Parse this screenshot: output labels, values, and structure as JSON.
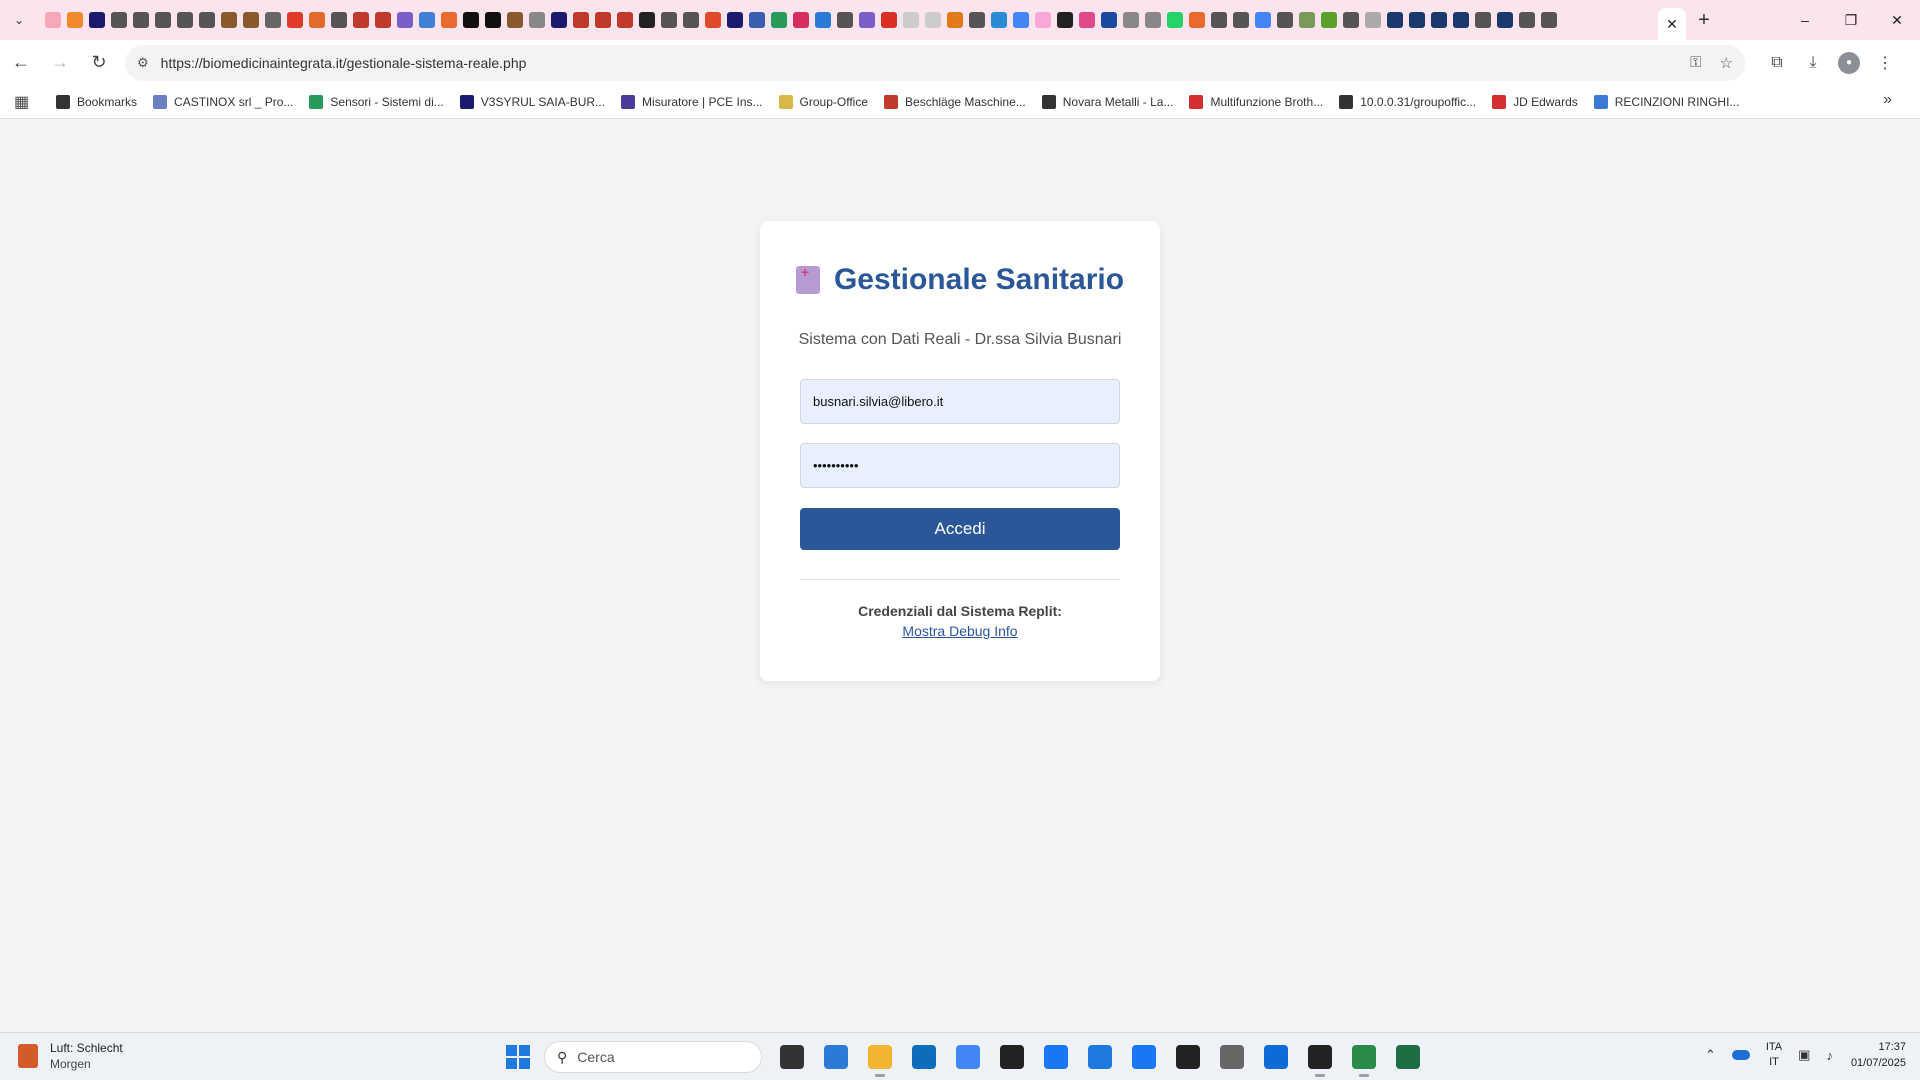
{
  "colors": {
    "accent": "#2b5799",
    "tabstrip": "#fce4ef",
    "field_bg": "#e8f0fe"
  },
  "browser": {
    "url": "https://biomedicinaintegrata.it/gestionale-sistema-reale.php",
    "tab_favicons": [
      "#f7a8b8",
      "#f08a2c",
      "#1a1a6e",
      "#555",
      "#555",
      "#555",
      "#555",
      "#555",
      "#8b5a2b",
      "#8b5a2b",
      "#666",
      "#e03a2a",
      "#e06b2a",
      "#555",
      "#c0392b",
      "#c0392b",
      "#7a5fc9",
      "#3f7fd6",
      "#e86a2c",
      "#111",
      "#111",
      "#8b5a2b",
      "#888",
      "#1a1a6e",
      "#c0392b",
      "#c0392b",
      "#c0392b",
      "#222",
      "#555",
      "#555",
      "#e04a2a",
      "#1a1a6e",
      "#3a5fb0",
      "#2a9a5a",
      "#d62e5e",
      "#2a7ad6",
      "#555",
      "#7a5fc9",
      "#d93025",
      "#ccc",
      "#ccc",
      "#e07a1a",
      "#555",
      "#2a8ad6",
      "#4285f4",
      "#f7a8d8",
      "#222",
      "#e04a8a",
      "#1a4a9e",
      "#888",
      "#888",
      "#25d366",
      "#e86a2c",
      "#555",
      "#555",
      "#4285f4",
      "#555",
      "#7a9a5a",
      "#5aa02a",
      "#555",
      "#aaa",
      "#1a3a6e",
      "#1a3a6e",
      "#1a3a6e",
      "#1a3a6e",
      "#555",
      "#1a3a6e",
      "#555",
      "#555"
    ],
    "icons": {
      "tab_list": "chevron-down-icon",
      "tab_close": "close-icon",
      "new_tab": "plus-icon",
      "back": "arrow-left-icon",
      "forward": "arrow-right-icon",
      "reload": "reload-icon",
      "site_info": "site-settings-icon",
      "password_key": "key-icon",
      "bookmark_star": "star-icon",
      "extensions": "puzzle-icon",
      "downloads": "download-icon",
      "menu": "kebab-menu-icon"
    }
  },
  "bookmarks": [
    {
      "label": "Bookmarks",
      "color": "#333"
    },
    {
      "label": "CASTINOX srl _ Pro...",
      "color": "#6a7fc1"
    },
    {
      "label": "Sensori - Sistemi di...",
      "color": "#2a9a5a"
    },
    {
      "label": "V3SYRUL SAIA-BUR...",
      "color": "#1a1a6e"
    },
    {
      "label": "Misuratore | PCE Ins...",
      "color": "#4a3a9a"
    },
    {
      "label": "Group-Office",
      "color": "#d9b84a"
    },
    {
      "label": "Beschläge Maschine...",
      "color": "#c0392b"
    },
    {
      "label": "Novara Metalli - La...",
      "color": "#333"
    },
    {
      "label": "Multifunzione Broth...",
      "color": "#d32f2f"
    },
    {
      "label": "10.0.0.31/groupoffic...",
      "color": "#333"
    },
    {
      "label": "JD Edwards",
      "color": "#d32f2f"
    },
    {
      "label": "RECINZIONI RINGHI...",
      "color": "#3a7ad6"
    }
  ],
  "login": {
    "title": "Gestionale Sanitario",
    "subtitle": "Sistema con Dati Reali - Dr.ssa Silvia Busnari",
    "email_value": "busnari.silvia@libero.it",
    "password_value": "••••••••••",
    "submit_label": "Accedi",
    "credentials_label": "Credenziali dal Sistema Replit:",
    "debug_link": "Mostra Debug Info"
  },
  "taskbar": {
    "weather_title": "Luft: Schlecht",
    "weather_sub": "Morgen",
    "search_placeholder": "Cerca",
    "apps": [
      {
        "name": "file-explorer-dark",
        "color": "#333",
        "state": ""
      },
      {
        "name": "news-widget",
        "color": "#2a7ad6",
        "state": ""
      },
      {
        "name": "file-explorer",
        "color": "#f2b530",
        "state": "running"
      },
      {
        "name": "outlook",
        "color": "#0f6cbd",
        "state": ""
      },
      {
        "name": "chrome",
        "color": "#4285f4",
        "state": "active"
      },
      {
        "name": "amazon",
        "color": "#222",
        "state": ""
      },
      {
        "name": "facebook",
        "color": "#1877f2",
        "state": ""
      },
      {
        "name": "search-app",
        "color": "#1f7ae0",
        "state": ""
      },
      {
        "name": "facebook-2",
        "color": "#1877f2",
        "state": ""
      },
      {
        "name": "store",
        "color": "#222",
        "state": ""
      },
      {
        "name": "media-player",
        "color": "#666",
        "state": ""
      },
      {
        "name": "teamviewer",
        "color": "#0e6ad6",
        "state": ""
      },
      {
        "name": "terminal",
        "color": "#222",
        "state": "running"
      },
      {
        "name": "network-tool",
        "color": "#2a8a4a",
        "state": "running"
      },
      {
        "name": "excel",
        "color": "#1d6f42",
        "state": ""
      }
    ],
    "language_top": "ITA",
    "language_bottom": "IT",
    "time": "17:37",
    "date": "01/07/2025"
  }
}
